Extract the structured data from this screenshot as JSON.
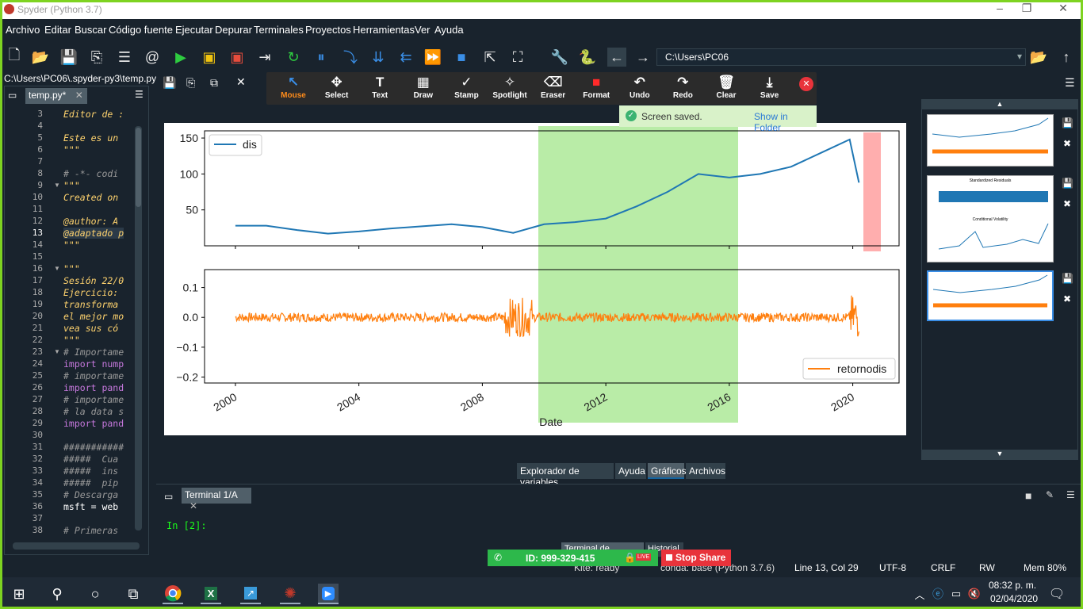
{
  "window": {
    "title": "Spyder (Python 3.7)"
  },
  "menu": [
    "Archivo",
    "Editar",
    "Buscar",
    "Código fuente",
    "Ejecutar",
    "Depurar",
    "Terminales",
    "Proyectos",
    "Herramientas",
    "Ver",
    "Ayuda"
  ],
  "toolbar": {
    "path": "C:\\Users\\PC06"
  },
  "editor": {
    "file_path": "C:\\Users\\PC06\\.spyder-py3\\temp.py",
    "tab_label": "temp.py*",
    "lines": [
      {
        "n": "3",
        "t": "Editor de :",
        "c": "#ffd36e",
        "i": true
      },
      {
        "n": "4",
        "t": "",
        "c": "#ffd36e",
        "i": true
      },
      {
        "n": "5",
        "t": "Este es un",
        "c": "#ffd36e",
        "i": true
      },
      {
        "n": "6",
        "t": "\"\"\"",
        "c": "#ffd36e",
        "i": true
      },
      {
        "n": "7",
        "t": "",
        "c": "#ffd36e",
        "i": false
      },
      {
        "n": "8",
        "t": "# -*- codi",
        "c": "#999999",
        "i": true
      },
      {
        "n": "9",
        "t": "\"\"\"",
        "c": "#ffd36e",
        "i": true
      },
      {
        "n": "10",
        "t": "Created on",
        "c": "#ffd36e",
        "i": true
      },
      {
        "n": "11",
        "t": "",
        "c": "#ffd36e",
        "i": false
      },
      {
        "n": "12",
        "t": "@author: A",
        "c": "#ffd36e",
        "i": true
      },
      {
        "n": "13",
        "t": "@adaptado p",
        "c": "#ffd36e",
        "i": true
      },
      {
        "n": "14",
        "t": "\"\"\"",
        "c": "#ffd36e",
        "i": true
      },
      {
        "n": "15",
        "t": "",
        "c": "#ffd36e",
        "i": false
      },
      {
        "n": "16",
        "t": "\"\"\"",
        "c": "#ffd36e",
        "i": true
      },
      {
        "n": "17",
        "t": "Sesión 22/0",
        "c": "#ffd36e",
        "i": true
      },
      {
        "n": "18",
        "t": "Ejercicio:",
        "c": "#ffd36e",
        "i": true
      },
      {
        "n": "19",
        "t": "transforma",
        "c": "#ffd36e",
        "i": true
      },
      {
        "n": "20",
        "t": "el mejor mo",
        "c": "#ffd36e",
        "i": true
      },
      {
        "n": "21",
        "t": "vea sus có",
        "c": "#ffd36e",
        "i": true
      },
      {
        "n": "22",
        "t": "\"\"\"",
        "c": "#ffd36e",
        "i": true
      },
      {
        "n": "23",
        "t": "# Importame",
        "c": "#999999",
        "i": true
      },
      {
        "n": "24",
        "t": "import nump",
        "c": "#ffffff",
        "i": false,
        "kw": "import"
      },
      {
        "n": "25",
        "t": "# importame",
        "c": "#999999",
        "i": true
      },
      {
        "n": "26",
        "t": "import pand",
        "c": "#ffffff",
        "i": false,
        "kw": "import"
      },
      {
        "n": "27",
        "t": "# importame",
        "c": "#999999",
        "i": true
      },
      {
        "n": "28",
        "t": "# la data s",
        "c": "#999999",
        "i": true
      },
      {
        "n": "29",
        "t": "import pand",
        "c": "#ffffff",
        "i": false,
        "kw": "import"
      },
      {
        "n": "30",
        "t": "",
        "c": "#fff",
        "i": false
      },
      {
        "n": "31",
        "t": "###########",
        "c": "#999999",
        "i": true
      },
      {
        "n": "32",
        "t": "#####  Cua",
        "c": "#999999",
        "i": true
      },
      {
        "n": "33",
        "t": "#####  ins",
        "c": "#999999",
        "i": true
      },
      {
        "n": "34",
        "t": "#####  pip",
        "c": "#999999",
        "i": true
      },
      {
        "n": "35",
        "t": "# Descarga",
        "c": "#999999",
        "i": true
      },
      {
        "n": "36",
        "t": "msft = web",
        "c": "#ffffff",
        "i": false
      },
      {
        "n": "37",
        "t": "",
        "c": "#fff",
        "i": false
      },
      {
        "n": "38",
        "t": "# Primeras",
        "c": "#999999",
        "i": true
      }
    ]
  },
  "annotation_tools": [
    {
      "label": "Mouse",
      "icon": "↖",
      "color": "#ff8c1a"
    },
    {
      "label": "Select",
      "icon": "✥",
      "color": "#ffffff"
    },
    {
      "label": "Text",
      "icon": "T",
      "color": "#ffffff"
    },
    {
      "label": "Draw",
      "icon": "▦",
      "color": "#ffffff"
    },
    {
      "label": "Stamp",
      "icon": "✓",
      "color": "#ffffff"
    },
    {
      "label": "Spotlight",
      "icon": "✧",
      "color": "#ffffff"
    },
    {
      "label": "Eraser",
      "icon": "⌫",
      "color": "#ffffff"
    },
    {
      "label": "Format",
      "icon": "■",
      "color": "#ffffff"
    },
    {
      "label": "Undo",
      "icon": "↶",
      "color": "#ffffff"
    },
    {
      "label": "Redo",
      "icon": "↷",
      "color": "#ffffff"
    },
    {
      "label": "Clear",
      "icon": "🗑",
      "color": "#ffffff"
    },
    {
      "label": "Save",
      "icon": "⤓",
      "color": "#ffffff"
    }
  ],
  "toast": {
    "message": "Screen saved.",
    "link": "Show in Folder"
  },
  "chart_data": [
    {
      "type": "line",
      "series": [
        {
          "name": "dis"
        }
      ],
      "x": [
        2000,
        2001,
        2002,
        2003,
        2004,
        2005,
        2006,
        2007,
        2008,
        2009,
        2010,
        2011,
        2012,
        2013,
        2014,
        2015,
        2016,
        2017,
        2018,
        2019,
        2019.9,
        2020.2
      ],
      "values": [
        28,
        28,
        22,
        17,
        20,
        24,
        27,
        30,
        26,
        18,
        30,
        33,
        38,
        55,
        75,
        100,
        95,
        100,
        110,
        130,
        148,
        88
      ],
      "yticks": [
        "50",
        "100",
        "150"
      ],
      "ylim": [
        0,
        160
      ]
    },
    {
      "type": "line",
      "series": [
        {
          "name": "retornodis"
        }
      ],
      "yticks": [
        "0.1",
        "0.0",
        "−0.1",
        "−0.2"
      ],
      "ylim": [
        -0.22,
        0.16
      ],
      "xticks": [
        "2000",
        "2004",
        "2008",
        "2012",
        "2016",
        "2020"
      ],
      "xlabel": "Date"
    }
  ],
  "right_panel": {
    "thumb2_title": "Standardized Residuals",
    "thumb2_sub": "Conditional Volatility"
  },
  "pane_tabs": [
    "Explorador de variables",
    "Ayuda",
    "Gráficos",
    "Archivos"
  ],
  "terminal": {
    "tab_label": "Terminal 1/A",
    "prompt": "In [2]:",
    "bottom_tabs": [
      "Terminal de IPython",
      "Historial"
    ]
  },
  "share": {
    "id_text": "ID: 999-329-415",
    "live": "LIVE",
    "stop_label": "Stop Share"
  },
  "status": {
    "kite": "Kite: ready",
    "conda": "conda: base (Python 3.7.6)",
    "position": "Line 13, Col 29",
    "encoding": "UTF-8",
    "eol": "CRLF",
    "mode": "RW",
    "mem": "Mem 80%"
  },
  "taskbar": {
    "time": "08:32 p. m.",
    "date": "02/04/2020"
  }
}
